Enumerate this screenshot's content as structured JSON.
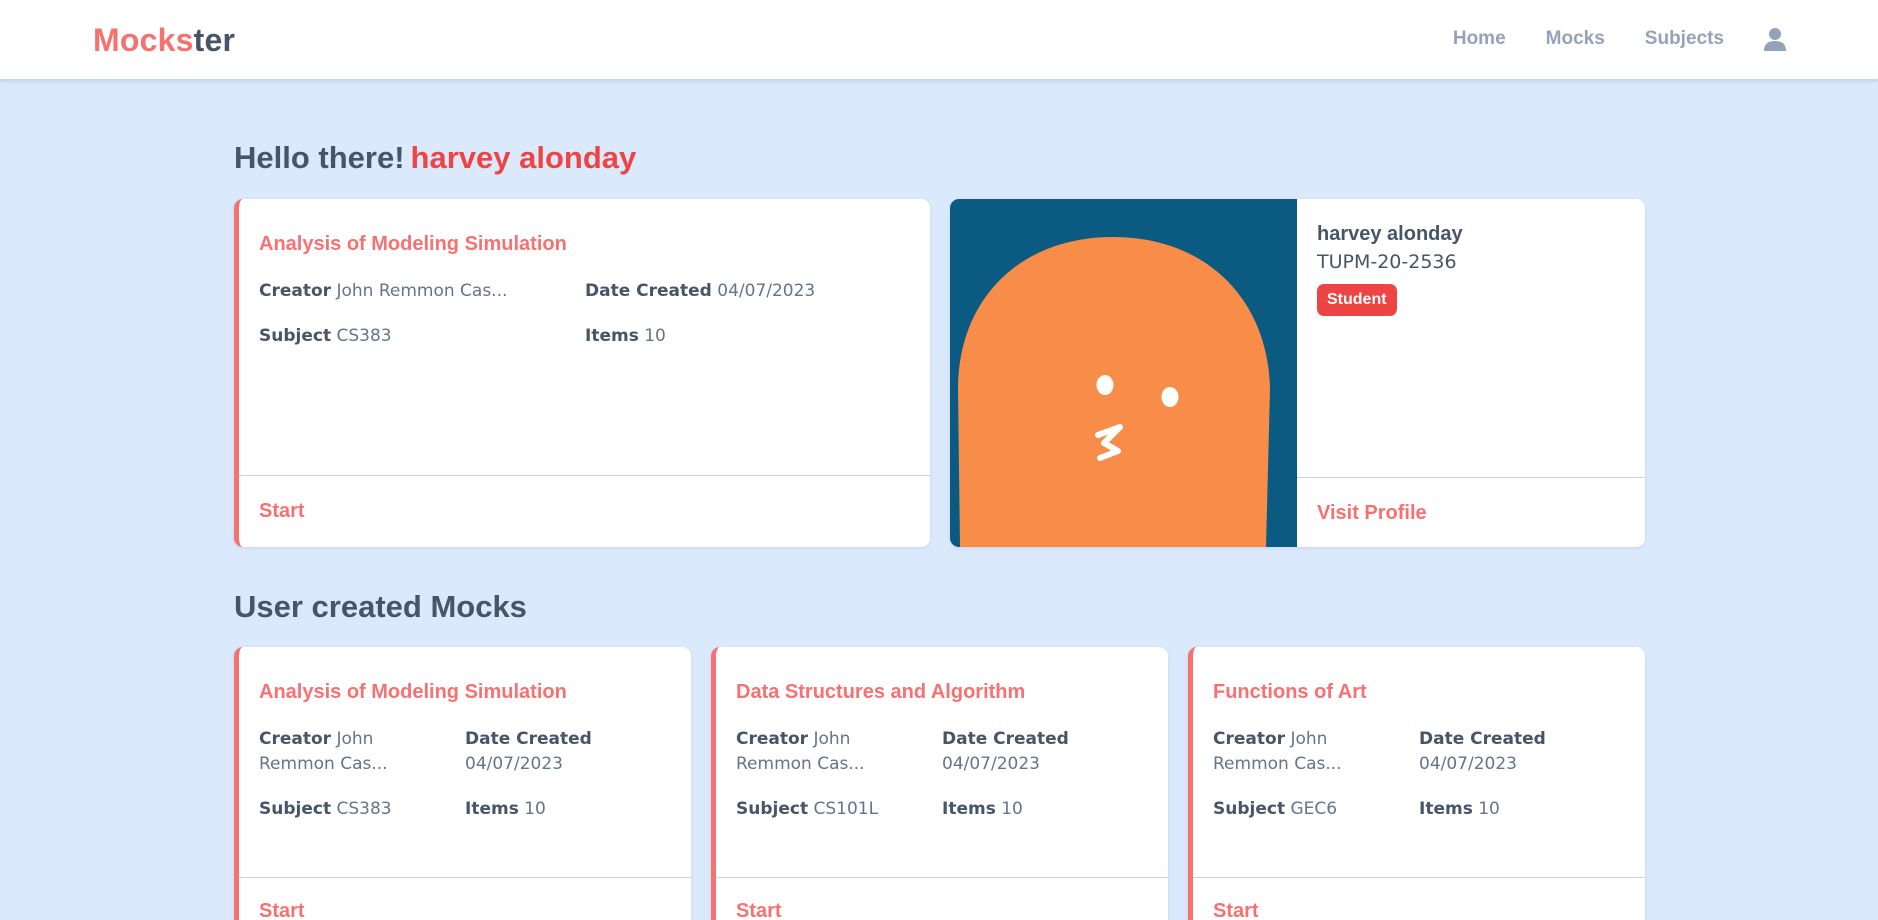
{
  "brand": {
    "part1": "Mocks",
    "part2": "ter"
  },
  "nav": {
    "home": "Home",
    "mocks": "Mocks",
    "subjects": "Subjects"
  },
  "greeting": {
    "prefix": "Hello there!",
    "name": "harvey alonday"
  },
  "featured_mock": {
    "title": "Analysis of Modeling Simulation",
    "creator_label": "Creator",
    "creator": "John Remmon Cas...",
    "date_label": "Date Created",
    "date": "04/07/2023",
    "subject_label": "Subject",
    "subject": "CS383",
    "items_label": "Items",
    "items": "10",
    "start": "Start"
  },
  "profile": {
    "name": "harvey alonday",
    "id": "TUPM-20-2536",
    "role": "Student",
    "visit": "Visit Profile"
  },
  "section_title": "User created Mocks",
  "mocks": [
    {
      "title": "Analysis of Modeling Simulation",
      "creator_label": "Creator",
      "creator": "John Remmon Cas...",
      "date_label": "Date Created",
      "date": "04/07/2023",
      "subject_label": "Subject",
      "subject": "CS383",
      "items_label": "Items",
      "items": "10",
      "start": "Start"
    },
    {
      "title": "Data Structures and Algorithm",
      "creator_label": "Creator",
      "creator": "John Remmon Cas...",
      "date_label": "Date Created",
      "date": "04/07/2023",
      "subject_label": "Subject",
      "subject": "CS101L",
      "items_label": "Items",
      "items": "10",
      "start": "Start"
    },
    {
      "title": "Functions of Art",
      "creator_label": "Creator",
      "creator": "John Remmon Cas...",
      "date_label": "Date Created",
      "date": "04/07/2023",
      "subject_label": "Subject",
      "subject": "GEC6",
      "items_label": "Items",
      "items": "10",
      "start": "Start"
    }
  ],
  "icons": {
    "user": "user-icon"
  },
  "colors": {
    "accent": "#f87171",
    "accent_strong": "#ef4444",
    "background": "#dbe9fd",
    "avatar_bg": "#0b5a82",
    "avatar_body": "#f78d49"
  }
}
